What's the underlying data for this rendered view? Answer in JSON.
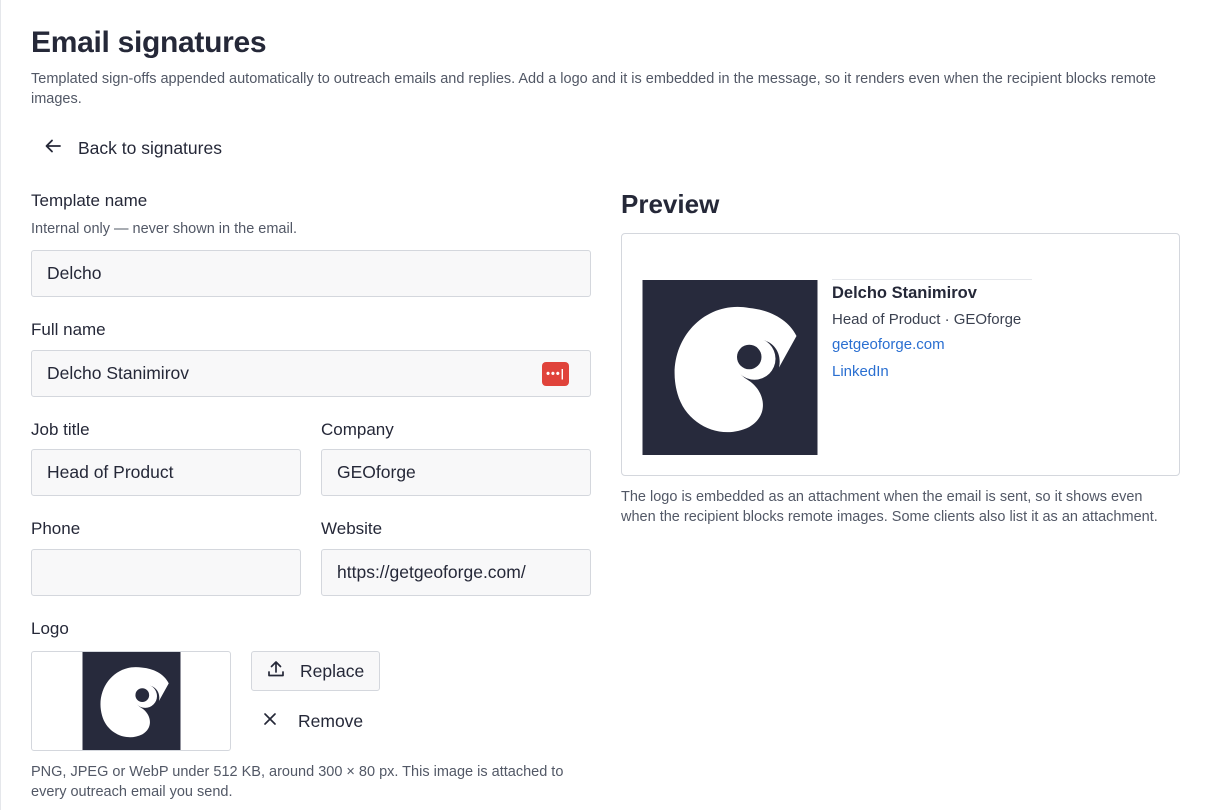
{
  "header": {
    "title": "Email signatures",
    "description": "Templated sign-offs appended automatically to outreach emails and replies. Add a logo and it is embedded in the message, so it renders even when the recipient blocks remote images."
  },
  "back": {
    "label": "Back to signatures",
    "icon": "arrow-left-icon"
  },
  "form": {
    "template_name": {
      "label": "Template name",
      "hint": "Internal only — never shown in the email.",
      "value": "Delcho"
    },
    "full_name": {
      "label": "Full name",
      "value": "Delcho Stanimirov",
      "password_manager_icon": "•••|"
    },
    "job_title": {
      "label": "Job title",
      "value": "Head of Product"
    },
    "company": {
      "label": "Company",
      "value": "GEOforge"
    },
    "phone": {
      "label": "Phone",
      "value": ""
    },
    "website": {
      "label": "Website",
      "value": "https://getgeoforge.com/"
    },
    "logo": {
      "label": "Logo",
      "replace_label": "Replace",
      "remove_label": "Remove",
      "hint": "PNG, JPEG or WebP under 512 KB, around 300 × 80 px. This image is attached to every outreach email you send."
    }
  },
  "preview": {
    "title": "Preview",
    "name": "Delcho Stanimirov",
    "role": "Head of Product · GEOforge",
    "website_link": "getgeoforge.com",
    "linkedin_link": "LinkedIn",
    "note": "The logo is embedded as an attachment when the email is sent, so it shows even when the recipient blocks remote images. Some clients also list it as an attachment."
  },
  "colors": {
    "logo_bg": "#272a3c",
    "link": "#2a6fd1",
    "password_manager": "#e0433b"
  }
}
